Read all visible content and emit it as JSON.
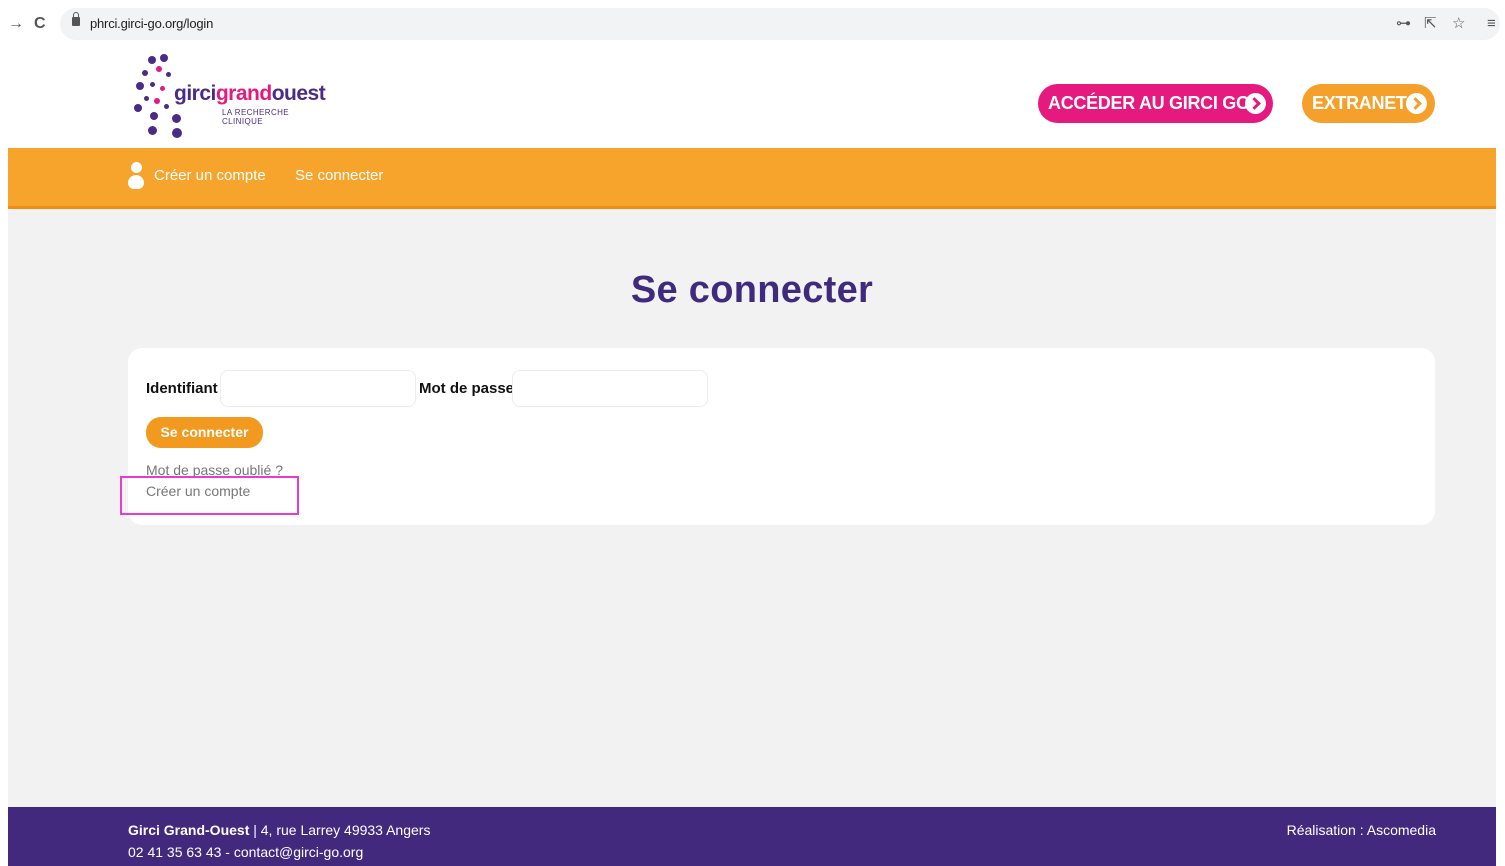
{
  "browser": {
    "url": "phrci.girci-go.org/login",
    "forward_icon": "→",
    "reload_icon": "C",
    "key_icon": "⊶",
    "share_icon": "⇱",
    "star_icon": "☆",
    "menu_icon": "≡"
  },
  "header": {
    "logo_part1": "girci",
    "logo_part2": "grand",
    "logo_part3": "ouest",
    "logo_tagline": "LA RECHERCHE CLINIQUE",
    "girci_button": "ACCÉDER AU GIRCI GO",
    "extranet_button": "EXTRANET"
  },
  "nav": {
    "create_account": "Créer un compte",
    "login": "Se connecter"
  },
  "main": {
    "title": "Se connecter",
    "username_label": "Identifiant",
    "username_value": "",
    "password_label": "Mot de passe",
    "password_value": "",
    "submit_label": "Se connecter",
    "forgot_link": "Mot de passe oublié ?",
    "create_link": "Créer un compte"
  },
  "footer": {
    "org_name": "Girci Grand-Ouest",
    "address": " | 4, rue Larrey 49933 Angers",
    "contact": "02 41 35 63 43 - contact@girci-go.org",
    "credit": "Réalisation : Ascomedia"
  },
  "colors": {
    "purple": "#42297e",
    "pink": "#e6197e",
    "orange": "#f6a42c",
    "highlight": "#ea3bd0"
  }
}
